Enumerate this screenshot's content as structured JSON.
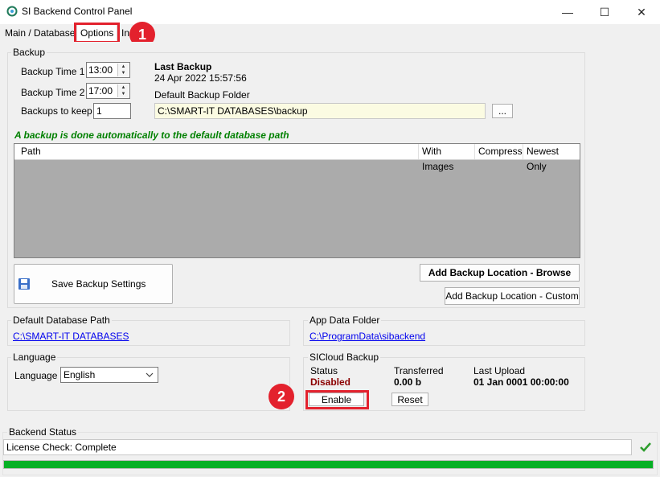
{
  "window": {
    "title": "SI Backend Control Panel",
    "minimize": "—",
    "maximize": "☐",
    "close": "✕"
  },
  "tabs": [
    {
      "label": "Main / Databases"
    },
    {
      "label": "Options"
    },
    {
      "label": "In",
      "trailing": "n"
    }
  ],
  "annotations": {
    "step1": "1",
    "step2": "2"
  },
  "backup": {
    "group_label": "Backup",
    "time1_label": "Backup Time 1",
    "time1_value": "13:00",
    "time2_label": "Backup Time 2",
    "time2_value": "17:00",
    "keep_label": "Backups to keep",
    "keep_value": "1",
    "last_backup_label": "Last Backup",
    "last_backup_value": "24 Apr 2022 15:57:56",
    "default_folder_label": "Default Backup Folder",
    "default_folder_value": "C:\\SMART-IT DATABASES\\backup",
    "browse_button": "...",
    "auto_note": "A backup is done automatically to the default database path",
    "columns": [
      "Path",
      "With Images",
      "Compress",
      "Newest Only"
    ],
    "save_button": "Save Backup Settings",
    "add_browse_button": "Add Backup Location - Browse",
    "add_custom_button": "Add Backup Location - Custom"
  },
  "db_path": {
    "group_label": "Default Database Path",
    "value": "C:\\SMART-IT DATABASES"
  },
  "app_data": {
    "group_label": "App Data Folder",
    "value": "C:\\ProgramData\\sibackend"
  },
  "language": {
    "group_label": "Language",
    "field_label": "Language",
    "value": "English"
  },
  "sicloud": {
    "group_label": "SICloud Backup",
    "status_label": "Status",
    "status_value": "Disabled",
    "transferred_label": "Transferred",
    "transferred_value": "0.00 b",
    "last_upload_label": "Last Upload",
    "last_upload_value": "01 Jan 0001 00:00:00",
    "enable_button": "Enable",
    "reset_button": "Reset"
  },
  "backend_status": {
    "group_label": "Backend Status",
    "message": "License Check: Complete",
    "progress": 1.0
  },
  "colors": {
    "accent_red": "#e3212d",
    "status_disabled": "#8b0000",
    "note_green": "#008000",
    "progress_green": "#06b025",
    "check_green": "#2e9e2e"
  }
}
